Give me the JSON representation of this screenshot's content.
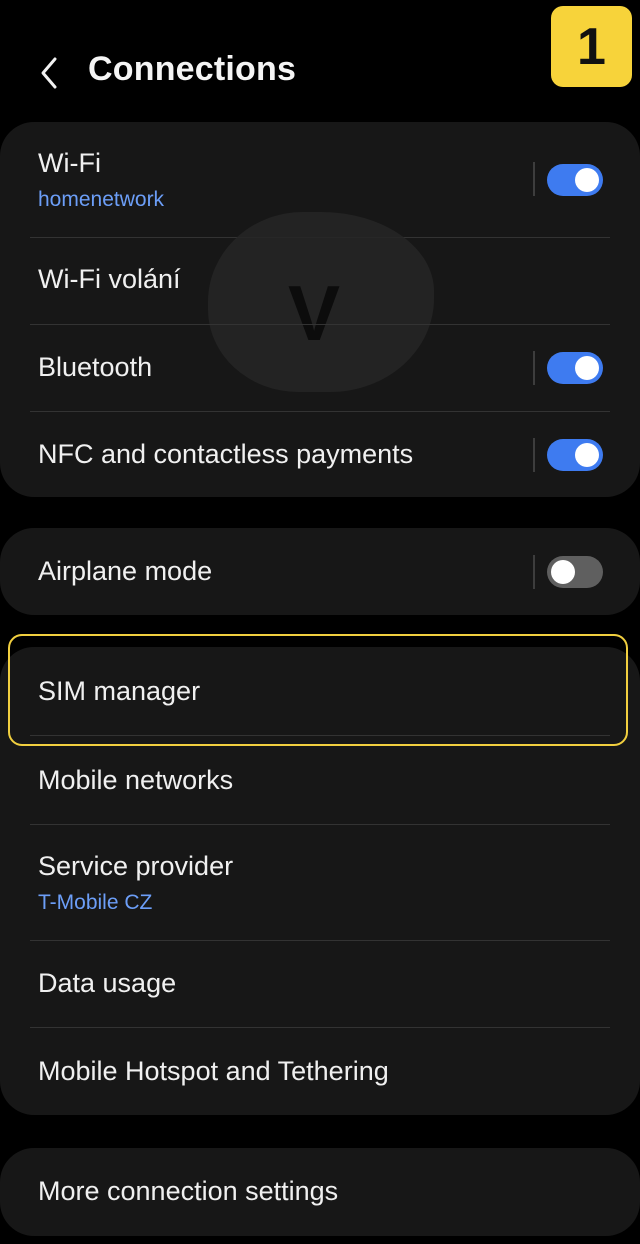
{
  "header": {
    "title": "Connections",
    "back_icon": "chevron-left-icon"
  },
  "step_badge": "1",
  "watermark": "V",
  "group1": {
    "wifi": {
      "label": "Wi-Fi",
      "sub": "homenetwork",
      "toggle": "on"
    },
    "wifi_calling": {
      "label": "Wi-Fi volání"
    },
    "bluetooth": {
      "label": "Bluetooth",
      "toggle": "on"
    },
    "nfc": {
      "label": "NFC and contactless payments",
      "toggle": "on"
    }
  },
  "group2": {
    "airplane": {
      "label": "Airplane mode",
      "toggle": "off"
    }
  },
  "group3": {
    "sim_manager": {
      "label": "SIM manager"
    },
    "mobile_networks": {
      "label": "Mobile networks"
    },
    "service_provider": {
      "label": "Service provider",
      "sub": "T-Mobile CZ"
    },
    "data_usage": {
      "label": "Data usage"
    },
    "hotspot": {
      "label": "Mobile Hotspot and Tethering"
    }
  },
  "group4": {
    "more_settings": {
      "label": "More connection settings"
    }
  },
  "colors": {
    "background": "#000000",
    "card": "#171717",
    "accent_blue": "#3e7bf0",
    "sub_text": "#6c9ef7",
    "highlight": "#f1cf3f",
    "badge": "#f7d33a"
  }
}
